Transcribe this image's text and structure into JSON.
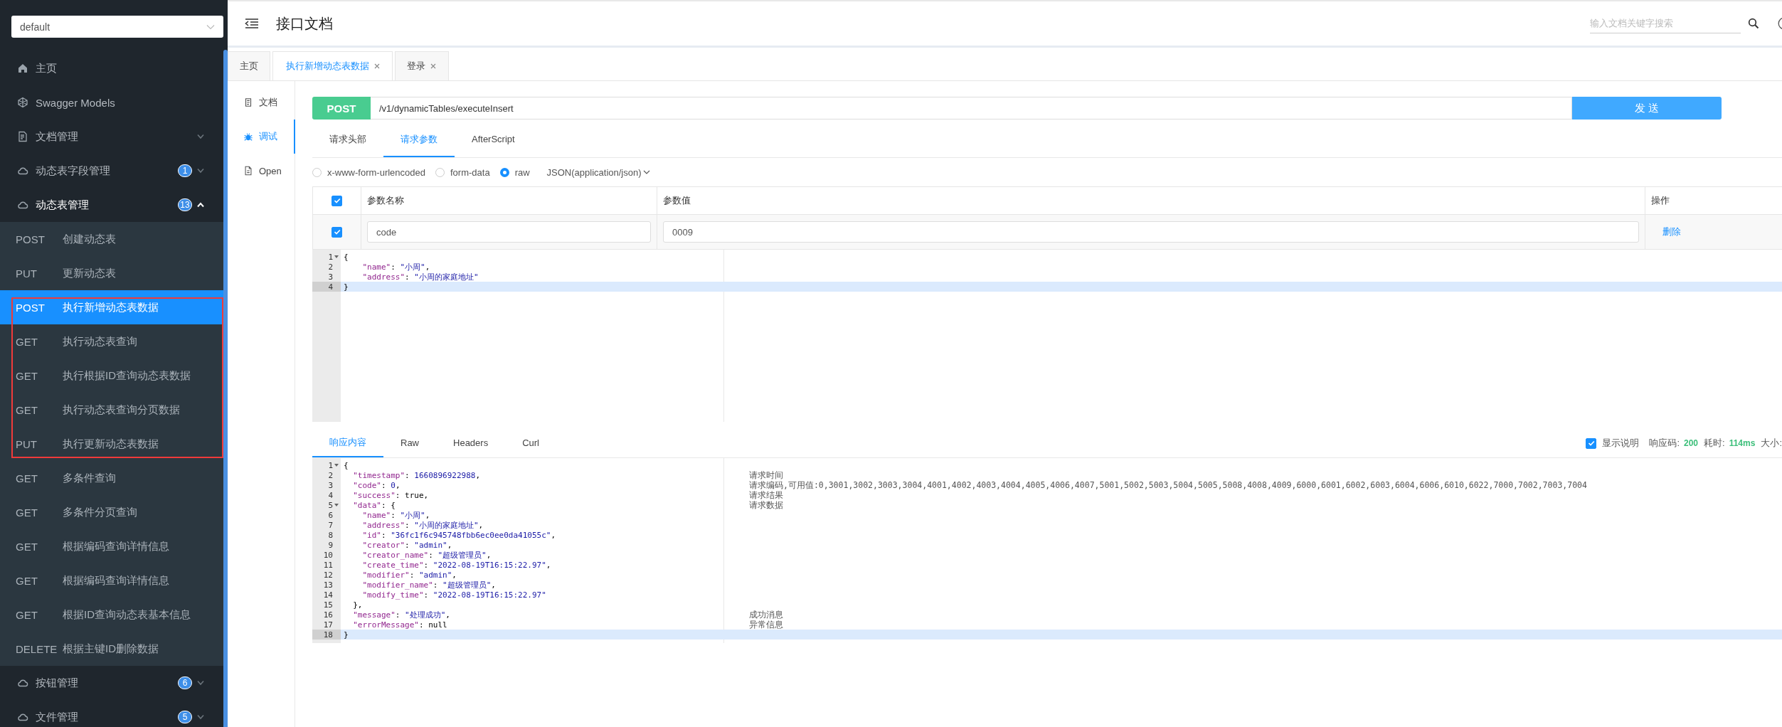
{
  "sidebar": {
    "group_select": {
      "value": "default"
    },
    "nav": [
      {
        "kind": "page",
        "label": "主页"
      },
      {
        "kind": "page",
        "label": "Swagger Models"
      },
      {
        "kind": "group",
        "label": "文档管理",
        "expanded": false
      },
      {
        "kind": "group",
        "label": "动态表字段管理",
        "badge": "1",
        "expanded": false
      },
      {
        "kind": "group",
        "label": "动态表管理",
        "badge": "13",
        "expanded": true,
        "children": [
          {
            "method": "POST",
            "label": "创建动态表",
            "selected": false,
            "highlighted": false
          },
          {
            "method": "PUT",
            "label": "更新动态表",
            "selected": false,
            "highlighted": false
          },
          {
            "method": "POST",
            "label": "执行新增动态表数据",
            "selected": true,
            "highlighted": true
          },
          {
            "method": "GET",
            "label": "执行动态表查询",
            "selected": false,
            "highlighted": true
          },
          {
            "method": "GET",
            "label": "执行根据ID查询动态表数据",
            "selected": false,
            "highlighted": true
          },
          {
            "method": "GET",
            "label": "执行动态表查询分页数据",
            "selected": false,
            "highlighted": true
          },
          {
            "method": "PUT",
            "label": "执行更新动态表数据",
            "selected": false,
            "highlighted": true
          },
          {
            "method": "GET",
            "label": "多条件查询",
            "selected": false,
            "highlighted": false
          },
          {
            "method": "GET",
            "label": "多条件分页查询",
            "selected": false,
            "highlighted": false
          },
          {
            "method": "GET",
            "label": "根据编码查询详情信息",
            "selected": false,
            "highlighted": false
          },
          {
            "method": "GET",
            "label": "根据编码查询详情信息",
            "selected": false,
            "highlighted": false
          },
          {
            "method": "GET",
            "label": "根据ID查询动态表基本信息",
            "selected": false,
            "highlighted": false
          },
          {
            "method": "DELETE",
            "label": "根据主键ID删除数据",
            "selected": false,
            "highlighted": false
          }
        ]
      },
      {
        "kind": "group",
        "label": "按钮管理",
        "badge": "6",
        "expanded": false
      },
      {
        "kind": "group",
        "label": "文件管理",
        "badge": "5",
        "expanded": false
      }
    ]
  },
  "header": {
    "title": "接口文档",
    "search": {
      "placeholder": "输入文档关键字搜索"
    }
  },
  "tabs": [
    {
      "label": "主页",
      "selected": false,
      "closable": false
    },
    {
      "label": "执行新增动态表数据",
      "selected": true,
      "closable": true
    },
    {
      "label": "登录",
      "selected": false,
      "closable": true
    }
  ],
  "subnav": [
    {
      "label": "文档",
      "selected": false
    },
    {
      "label": "调试",
      "selected": true
    },
    {
      "label": "Open",
      "selected": false
    }
  ],
  "request": {
    "method": "POST",
    "url": "/v1/dynamicTables/executeInsert",
    "send_label": "发 送",
    "tabs": [
      {
        "label": "请求头部",
        "selected": false
      },
      {
        "label": "请求参数",
        "selected": true
      },
      {
        "label": "AfterScript",
        "selected": false
      }
    ],
    "body_types": [
      {
        "label": "x-www-form-urlencoded",
        "selected": false
      },
      {
        "label": "form-data",
        "selected": false
      },
      {
        "label": "raw",
        "selected": true
      }
    ],
    "content_type": "JSON(application/json)",
    "params": {
      "all_checked": true,
      "columns": [
        "参数名称",
        "参数值",
        "操作"
      ],
      "rows": [
        {
          "checked": true,
          "name": "code",
          "value": "0009",
          "action": "删除"
        }
      ]
    },
    "editor": [
      {
        "no": "1",
        "code": "{",
        "fold": true,
        "active": false
      },
      {
        "no": "2",
        "code": "    \"name\": \"小周\",",
        "fold": false,
        "active": false
      },
      {
        "no": "3",
        "code": "    \"address\": \"小周的家庭地址\"",
        "fold": false,
        "active": false
      },
      {
        "no": "4",
        "code": "}",
        "fold": false,
        "active": true
      }
    ]
  },
  "response": {
    "tabs": [
      {
        "label": "响应内容",
        "selected": true
      },
      {
        "label": "Raw",
        "selected": false
      },
      {
        "label": "Headers",
        "selected": false
      },
      {
        "label": "Curl",
        "selected": false
      }
    ],
    "show_notes": {
      "label": "显示说明",
      "checked": true
    },
    "status_label": "响应码:",
    "status": "200",
    "time_label": "耗时:",
    "time": "114ms",
    "size_label": "大小:",
    "editor": [
      {
        "no": "1",
        "code": "{",
        "fold": true,
        "active": false
      },
      {
        "no": "2",
        "code": "  \"timestamp\": 1660896922988,",
        "fold": false,
        "active": false,
        "note": "请求时间"
      },
      {
        "no": "3",
        "code": "  \"code\": 0,",
        "fold": false,
        "active": false,
        "note": "请求编码,可用值:0,3001,3002,3003,3004,4001,4002,4003,4004,4005,4006,4007,5001,5002,5003,5004,5005,5008,4008,4009,6000,6001,6002,6003,6004,6006,6010,6022,7000,7002,7003,7004"
      },
      {
        "no": "4",
        "code": "  \"success\": true,",
        "fold": false,
        "active": false,
        "note": "请求结果"
      },
      {
        "no": "5",
        "code": "  \"data\": {",
        "fold": true,
        "active": false,
        "note": "请求数据"
      },
      {
        "no": "6",
        "code": "    \"name\": \"小周\",",
        "fold": false,
        "active": false
      },
      {
        "no": "7",
        "code": "    \"address\": \"小周的家庭地址\",",
        "fold": false,
        "active": false
      },
      {
        "no": "8",
        "code": "    \"id\": \"36fc1f6c945748fbb6ec0ee0da41055c\",",
        "fold": false,
        "active": false
      },
      {
        "no": "9",
        "code": "    \"creator\": \"admin\",",
        "fold": false,
        "active": false
      },
      {
        "no": "10",
        "code": "    \"creator_name\": \"超级管理员\",",
        "fold": false,
        "active": false
      },
      {
        "no": "11",
        "code": "    \"create_time\": \"2022-08-19T16:15:22.97\",",
        "fold": false,
        "active": false
      },
      {
        "no": "12",
        "code": "    \"modifier\": \"admin\",",
        "fold": false,
        "active": false
      },
      {
        "no": "13",
        "code": "    \"modifier_name\": \"超级管理员\",",
        "fold": false,
        "active": false
      },
      {
        "no": "14",
        "code": "    \"modify_time\": \"2022-08-19T16:15:22.97\"",
        "fold": false,
        "active": false
      },
      {
        "no": "15",
        "code": "  },",
        "fold": false,
        "active": false
      },
      {
        "no": "16",
        "code": "  \"message\": \"处理成功\",",
        "fold": false,
        "active": false,
        "note": "成功消息"
      },
      {
        "no": "17",
        "code": "  \"errorMessage\": null",
        "fold": false,
        "active": false,
        "note": "异常信息"
      },
      {
        "no": "18",
        "code": "}",
        "fold": false,
        "active": true
      }
    ]
  }
}
